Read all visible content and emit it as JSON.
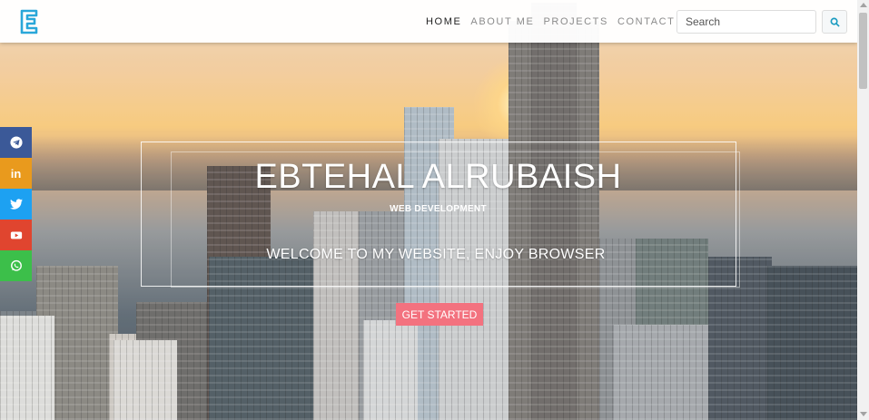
{
  "navbar": {
    "logo_letter": "E",
    "links": [
      {
        "label": "HOME",
        "active": true
      },
      {
        "label": "ABOUT ME",
        "active": false
      },
      {
        "label": "PROJECTS",
        "active": false
      },
      {
        "label": "CONTACT ME",
        "active": false
      }
    ],
    "search": {
      "placeholder": "Search",
      "icon": "search-icon"
    }
  },
  "hero": {
    "title": "EBTEHAL ALRUBAISH",
    "subtitle": "WEB DEVELOPMENT",
    "welcome": "WELCOME TO MY WEBSITE, ENJOY BROWSER",
    "cta_label": "GET STARTED"
  },
  "social": [
    {
      "name": "telegram",
      "icon": "telegram-icon",
      "color": "#3b5998"
    },
    {
      "name": "linkedin",
      "icon": "linkedin-icon",
      "color": "#e99a1d"
    },
    {
      "name": "twitter",
      "icon": "twitter-icon",
      "color": "#1da1f2"
    },
    {
      "name": "youtube",
      "icon": "youtube-icon",
      "color": "#e0452f"
    },
    {
      "name": "whatsapp",
      "icon": "whatsapp-icon",
      "color": "#3cbf4a"
    }
  ],
  "colors": {
    "accent": "#f3727f",
    "logo": "#2aa7d9",
    "search_icon": "#1a9bc0"
  }
}
